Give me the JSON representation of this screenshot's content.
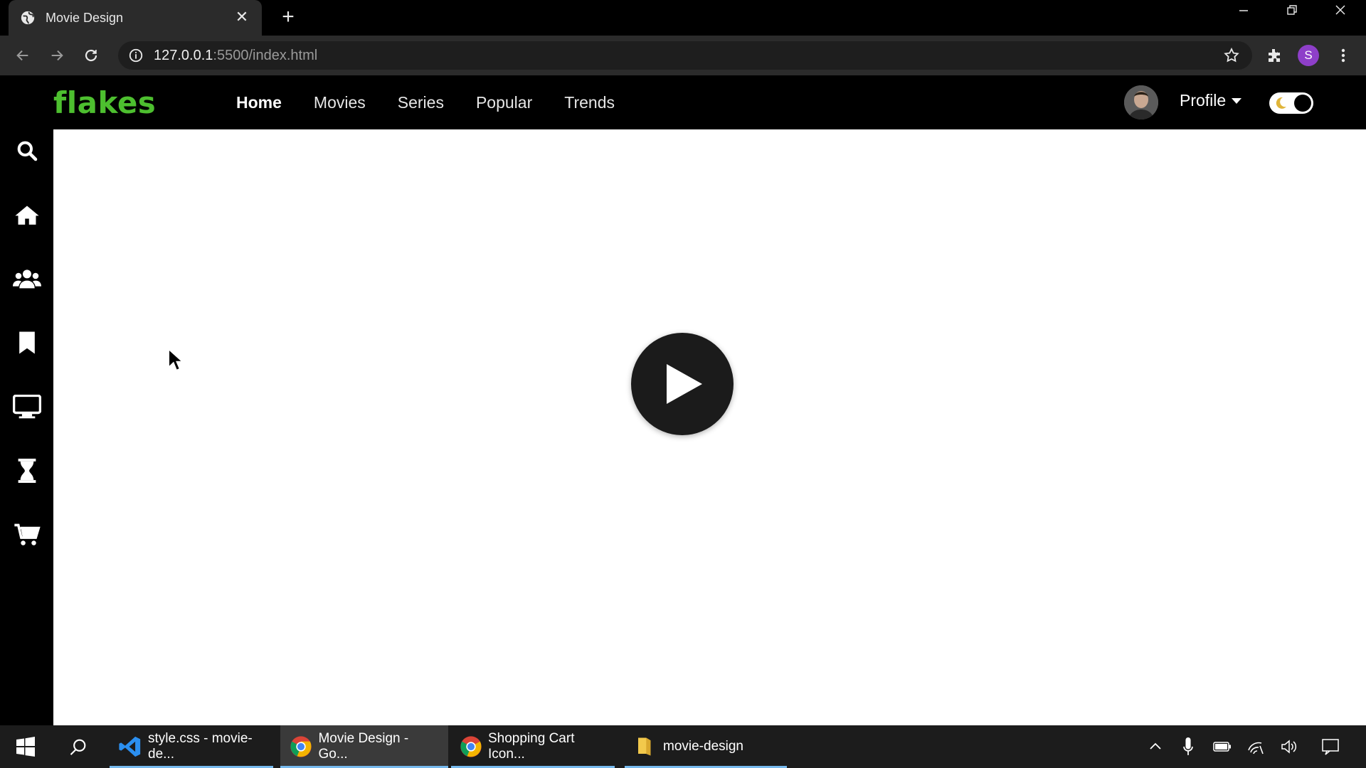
{
  "browser": {
    "tab_title": "Movie Design",
    "url_host": "127.0.0.1",
    "url_path": ":5500/index.html",
    "profile_initial": "S"
  },
  "site": {
    "logo": "flakes",
    "menu": [
      "Home",
      "Movies",
      "Series",
      "Popular",
      "Trends"
    ],
    "active_menu": "Home",
    "profile_label": "Profile",
    "toggle_state": "dark-mode-on"
  },
  "sidebar": {
    "icons": [
      "search-icon",
      "home-icon",
      "users-icon",
      "bookmark-icon",
      "tv-icon",
      "hourglass-icon",
      "cart-icon"
    ]
  },
  "main": {
    "play_icon": "play-icon"
  },
  "taskbar": {
    "items": [
      {
        "label": "style.css - movie-de...",
        "icon": "vscode-icon"
      },
      {
        "label": "Movie Design - Go...",
        "icon": "chrome-icon"
      },
      {
        "label": "Shopping Cart Icon...",
        "icon": "chrome-icon"
      },
      {
        "label": "movie-design",
        "icon": "folder-icon"
      }
    ]
  },
  "colors": {
    "logo_green": "#4dbf2f",
    "toggle_moon": "#e0b53a",
    "profile_badge": "#8e3fc9"
  }
}
